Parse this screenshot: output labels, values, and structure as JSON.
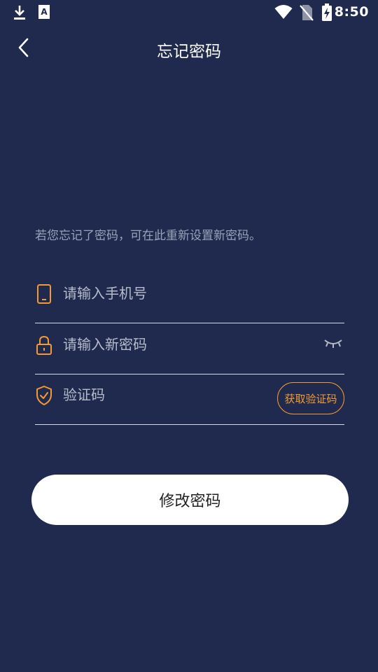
{
  "status_bar": {
    "time": "8:50",
    "left_icons": [
      "download-icon",
      "text-a-icon"
    ],
    "right_icons": [
      "wifi-icon",
      "no-sim-icon",
      "battery-charging-icon"
    ]
  },
  "header": {
    "title": "忘记密码",
    "back_icon": "chevron-left-icon"
  },
  "hint": "若您忘记了密码，可在此重新设置新密码。",
  "form": {
    "phone": {
      "placeholder": "请输入手机号",
      "value": "",
      "icon": "phone-icon"
    },
    "password": {
      "placeholder": "请输入新密码",
      "value": "",
      "icon": "lock-icon",
      "toggle_icon": "eye-closed-icon"
    },
    "code": {
      "placeholder": "验证码",
      "value": "",
      "icon": "shield-check-icon",
      "button_label": "获取验证码"
    }
  },
  "submit_label": "修改密码",
  "colors": {
    "background": "#1f2a4e",
    "accent": "#f29a33",
    "hint": "#9aa2b8"
  }
}
